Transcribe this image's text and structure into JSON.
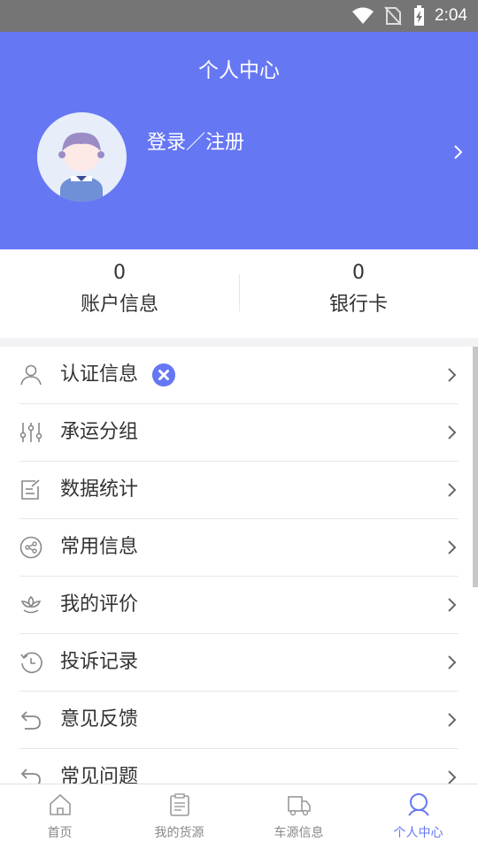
{
  "status_bar": {
    "time": "2:04"
  },
  "header": {
    "title": "个人中心",
    "login_text": "登录／注册"
  },
  "stats": [
    {
      "value": "0",
      "label": "账户信息"
    },
    {
      "value": "0",
      "label": "银行卡"
    }
  ],
  "menu": [
    {
      "label": "认证信息",
      "icon": "user-icon",
      "badge": "close-icon"
    },
    {
      "label": "承运分组",
      "icon": "sliders-icon"
    },
    {
      "label": "数据统计",
      "icon": "edit-document-icon"
    },
    {
      "label": "常用信息",
      "icon": "share-icon"
    },
    {
      "label": "我的评价",
      "icon": "lotus-icon"
    },
    {
      "label": "投诉记录",
      "icon": "history-icon"
    },
    {
      "label": "意见反馈",
      "icon": "undo-icon"
    },
    {
      "label": "常见问题",
      "icon": "undo-icon"
    }
  ],
  "bottom_nav": [
    {
      "label": "首页",
      "icon": "home-icon"
    },
    {
      "label": "我的货源",
      "icon": "clipboard-icon"
    },
    {
      "label": "车源信息",
      "icon": "truck-icon"
    },
    {
      "label": "个人中心",
      "icon": "person-icon",
      "active": true
    }
  ],
  "colors": {
    "accent": "#6677f4",
    "status_bar": "#757575"
  }
}
